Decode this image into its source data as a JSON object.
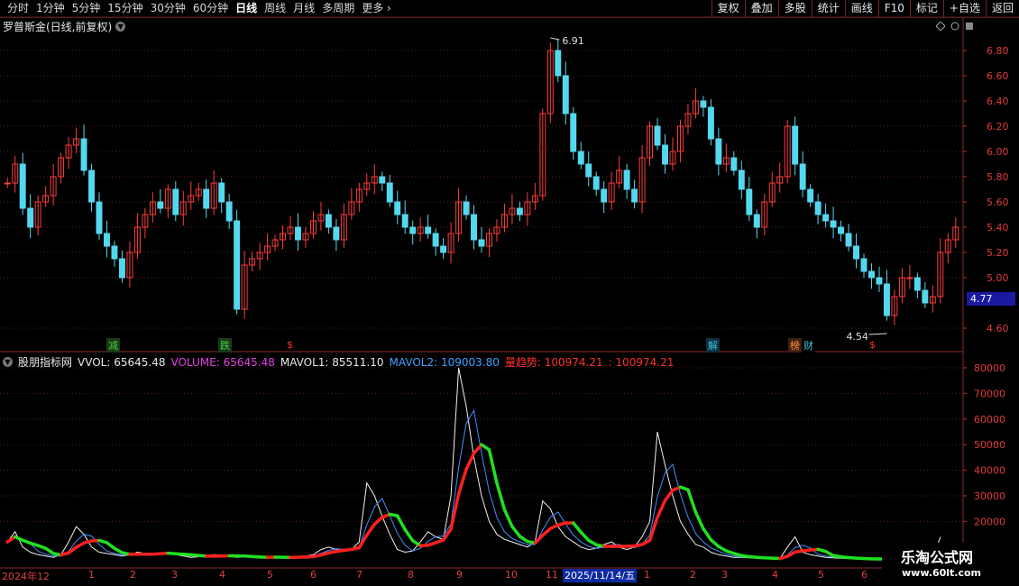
{
  "toolbar": {
    "periods": [
      "分时",
      "1分钟",
      "5分钟",
      "15分钟",
      "30分钟",
      "60分钟",
      "日线",
      "周线",
      "月线",
      "多周期",
      "更多"
    ],
    "active": "日线",
    "buttons": [
      "复权",
      "叠加",
      "多股",
      "统计",
      "画线",
      "F10",
      "标记",
      "+自选",
      "返回"
    ]
  },
  "title": {
    "stock": "罗普斯金(日线,前复权)"
  },
  "price_axis": {
    "labels": [
      "6.80",
      "6.60",
      "6.40",
      "6.20",
      "6.00",
      "5.80",
      "5.60",
      "5.40",
      "5.20",
      "5.00",
      "4.60"
    ],
    "current": "4.77"
  },
  "annotations": {
    "high": "6.91",
    "low": "4.54"
  },
  "signals": [
    {
      "text": "减",
      "color": "#40d040",
      "bg": "#1a3a1a"
    },
    {
      "text": "跌",
      "color": "#40d040",
      "bg": "#1a3a1a"
    },
    {
      "text": "$",
      "color": "#ff3030",
      "bg": "#000"
    },
    {
      "text": "解",
      "color": "#40c0e0",
      "bg": "#103040"
    },
    {
      "text": "榜",
      "color": "#ff9040",
      "bg": "#402010"
    },
    {
      "text": "财",
      "color": "#40c0e0",
      "bg": "#000"
    },
    {
      "text": "$",
      "color": "#ff3030",
      "bg": "#000"
    }
  ],
  "indicator": {
    "name": "股朋指标网",
    "vol": "VVOL: 65645.48",
    "volume": "VOLUME: 65645.48",
    "mavol1": "MAVOL1: 85511.10",
    "mavol2": "MAVOL2: 109003.80",
    "trend": "量趋势: 100974.21",
    "trend2": ": 100974.21",
    "axis": [
      "80000",
      "70000",
      "60000",
      "50000",
      "40000",
      "30000",
      "20000"
    ]
  },
  "dates": {
    "start": "2024年12",
    "months": [
      "1",
      "2",
      "3",
      "4",
      "5",
      "6",
      "7",
      "8",
      "9",
      "10",
      "11",
      "1",
      "2",
      "3",
      "4",
      "5",
      "6"
    ],
    "highlight": "2025/11/14/五"
  },
  "watermark": {
    "line1": "乐淘公式网",
    "line2": "www.60lt.com"
  },
  "colors": {
    "up": "#ff3c3c",
    "down": "#54d8f0",
    "grid": "#5a1e1e",
    "trend_up": "#ff2020",
    "trend_down": "#20e020"
  },
  "chart_data": {
    "type": "line",
    "series": [
      {
        "values": [
          5.75,
          5.9,
          5.55,
          5.4,
          5.6,
          5.65,
          5.8,
          5.95,
          6.05,
          6.1,
          5.85,
          5.6,
          5.35,
          5.25,
          5.15,
          5.0,
          5.2,
          5.4,
          5.5,
          5.6,
          5.55,
          5.7,
          5.5,
          5.6,
          5.65,
          5.7,
          5.55,
          5.75,
          5.6,
          5.45,
          4.75,
          5.1,
          5.15,
          5.2,
          5.25,
          5.3,
          5.35,
          5.4,
          5.3,
          5.35,
          5.45,
          5.5,
          5.4,
          5.3,
          5.5,
          5.6,
          5.7,
          5.75,
          5.8,
          5.75,
          5.6,
          5.5,
          5.4,
          5.35,
          5.4,
          5.35,
          5.25,
          5.2,
          5.35,
          5.6,
          5.5,
          5.3,
          5.25,
          5.35,
          5.4,
          5.5,
          5.55,
          5.5,
          5.6,
          5.65,
          6.3,
          6.8,
          6.6,
          6.3,
          6.0,
          5.9,
          5.8,
          5.7,
          5.6,
          5.75,
          5.85,
          5.7,
          5.6,
          5.95,
          6.2,
          6.05,
          5.9,
          6.0,
          6.2,
          6.3,
          6.4,
          6.35,
          6.1,
          5.9,
          5.95,
          5.85,
          5.7,
          5.5,
          5.4,
          5.6,
          5.75,
          5.8,
          6.2,
          5.9,
          5.7,
          5.6,
          5.5,
          5.45,
          5.4,
          5.35,
          5.25,
          5.15,
          5.05,
          5.0,
          4.95,
          4.7,
          4.85,
          5.0,
          5.0,
          4.9,
          4.8,
          4.85,
          5.2,
          5.3,
          5.4
        ]
      },
      {
        "values": [
          12000,
          16000,
          10000,
          8000,
          7000,
          6500,
          6000,
          7000,
          12000,
          18000,
          15000,
          10000,
          8000,
          7500,
          7000,
          6500,
          7000,
          8000,
          7500,
          7000,
          7500,
          8000,
          7000,
          6500,
          6000,
          6200,
          6500,
          7000,
          6800,
          6500,
          6000,
          6200,
          6000,
          5800,
          6000,
          6200,
          6000,
          5800,
          6000,
          6500,
          7000,
          9000,
          10000,
          9000,
          8500,
          9000,
          12000,
          35000,
          30000,
          22000,
          15000,
          9000,
          8000,
          8500,
          12000,
          16000,
          14000,
          13000,
          30000,
          80000,
          65000,
          45000,
          30000,
          20000,
          15000,
          13000,
          12000,
          11000,
          10000,
          12000,
          28000,
          25000,
          18000,
          14000,
          12000,
          10000,
          9000,
          9500,
          11000,
          12000,
          10000,
          9000,
          10000,
          14000,
          20000,
          55000,
          42000,
          30000,
          20000,
          15000,
          11000,
          10000,
          8000,
          7000,
          6500,
          6000,
          6000,
          5800,
          5600,
          5500,
          5400,
          5300,
          10000,
          14000,
          8000,
          7000,
          6500,
          6000,
          5800,
          5600,
          5500,
          5400,
          5300,
          5200,
          5100,
          5000,
          4900,
          4800,
          4700,
          4600,
          4500,
          4400,
          14000
        ]
      }
    ],
    "xlabel": "",
    "ylabel": ""
  }
}
